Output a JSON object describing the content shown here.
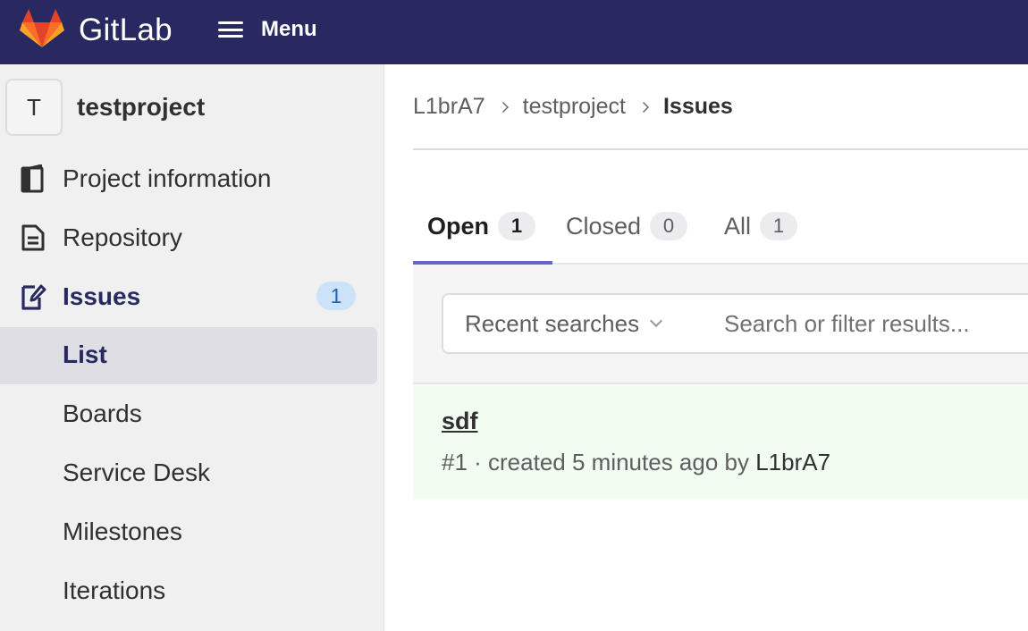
{
  "topbar": {
    "brand": "GitLab",
    "menu_label": "Menu",
    "colors": {
      "background": "#292961"
    }
  },
  "sidebar": {
    "project_initial": "T",
    "project_name": "testproject",
    "items": [
      {
        "label": "Project information",
        "icon": "project-information-icon"
      },
      {
        "label": "Repository",
        "icon": "document-icon"
      },
      {
        "label": "Issues",
        "icon": "issues-icon",
        "badge": "1",
        "active": true
      }
    ],
    "issues_subitems": [
      {
        "label": "List",
        "selected": true
      },
      {
        "label": "Boards"
      },
      {
        "label": "Service Desk"
      },
      {
        "label": "Milestones"
      },
      {
        "label": "Iterations"
      }
    ]
  },
  "breadcrumb": [
    "L1brA7",
    "testproject",
    "Issues"
  ],
  "tabs": [
    {
      "label": "Open",
      "count": "1",
      "active": true
    },
    {
      "label": "Closed",
      "count": "0"
    },
    {
      "label": "All",
      "count": "1"
    }
  ],
  "filter": {
    "recent_label": "Recent searches",
    "search_placeholder": "Search or filter results..."
  },
  "issues": [
    {
      "title": "sdf",
      "meta_prefix": "#1 · created 5 minutes ago by ",
      "author": "L1brA7"
    }
  ],
  "colors": {
    "accent": "#6666c4",
    "sidebar_bg": "#f0f0f0",
    "badge_bg": "#cbe2f9",
    "issue_row_bg": "#f1fdf0"
  }
}
